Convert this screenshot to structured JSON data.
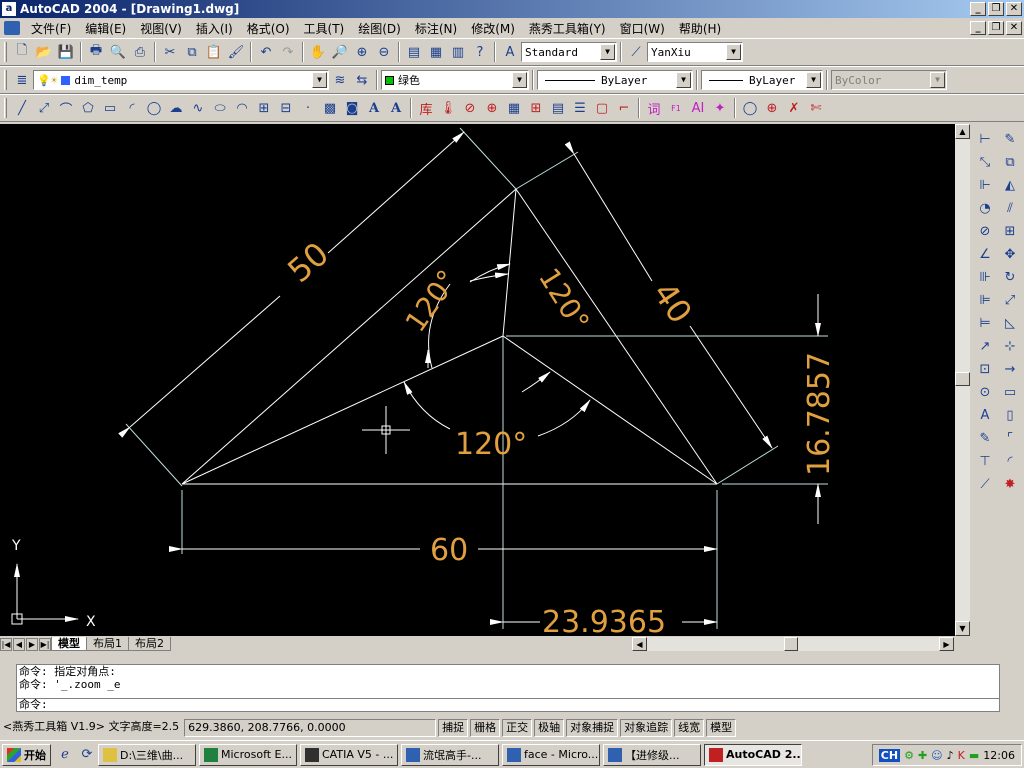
{
  "window": {
    "title": "AutoCAD 2004 - [Drawing1.dwg]"
  },
  "menu": [
    "文件(F)",
    "编辑(E)",
    "视图(V)",
    "插入(I)",
    "格式(O)",
    "工具(T)",
    "绘图(D)",
    "标注(N)",
    "修改(M)",
    "燕秀工具箱(Y)",
    "窗口(W)",
    "帮助(H)"
  ],
  "toolbar": {
    "text_style": "Standard",
    "dim_style": "YanXiu",
    "layer": "dim_temp",
    "color": "绿色",
    "linetype": "ByLayer",
    "lineweight": "ByLayer",
    "plotstyle": "ByColor",
    "draw_text_a": "A",
    "draw_text_b": "A",
    "ku_label": "库",
    "ci_label": "词",
    "ai_label": "AI"
  },
  "colors": {
    "layer_color": "#00c000",
    "dim_color": "#e0a040",
    "line_color": "#ffffff"
  },
  "drawing": {
    "dims": {
      "d50": "50",
      "d40": "40",
      "d60": "60",
      "d16": "16.7857",
      "d23": "23.9365",
      "a1": "120°",
      "a2": "120°",
      "a3": "120°"
    },
    "ucs_x": "X",
    "ucs_y": "Y"
  },
  "tabs": [
    "模型",
    "布局1",
    "布局2"
  ],
  "command": {
    "line1": "命令: 指定对角点:",
    "line2": "命令: '_.zoom _e",
    "prompt": "命令:"
  },
  "status": {
    "plugin": "<燕秀工具箱 V1.9> 文字高度=2.5",
    "coords": "629.3860, 208.7766, 0.0000",
    "toggles": [
      "捕捉",
      "栅格",
      "正交",
      "极轴",
      "对象捕捉",
      "对象追踪",
      "线宽",
      "模型"
    ]
  },
  "taskbar": {
    "start": "开始",
    "items": [
      "D:\\三维\\曲...",
      "Microsoft E...",
      "CATIA V5 - ...",
      "流氓高手-...",
      "face - Micro...",
      "【进修级...",
      "AutoCAD 2..."
    ],
    "ime": "CH",
    "clock": "12:06"
  }
}
